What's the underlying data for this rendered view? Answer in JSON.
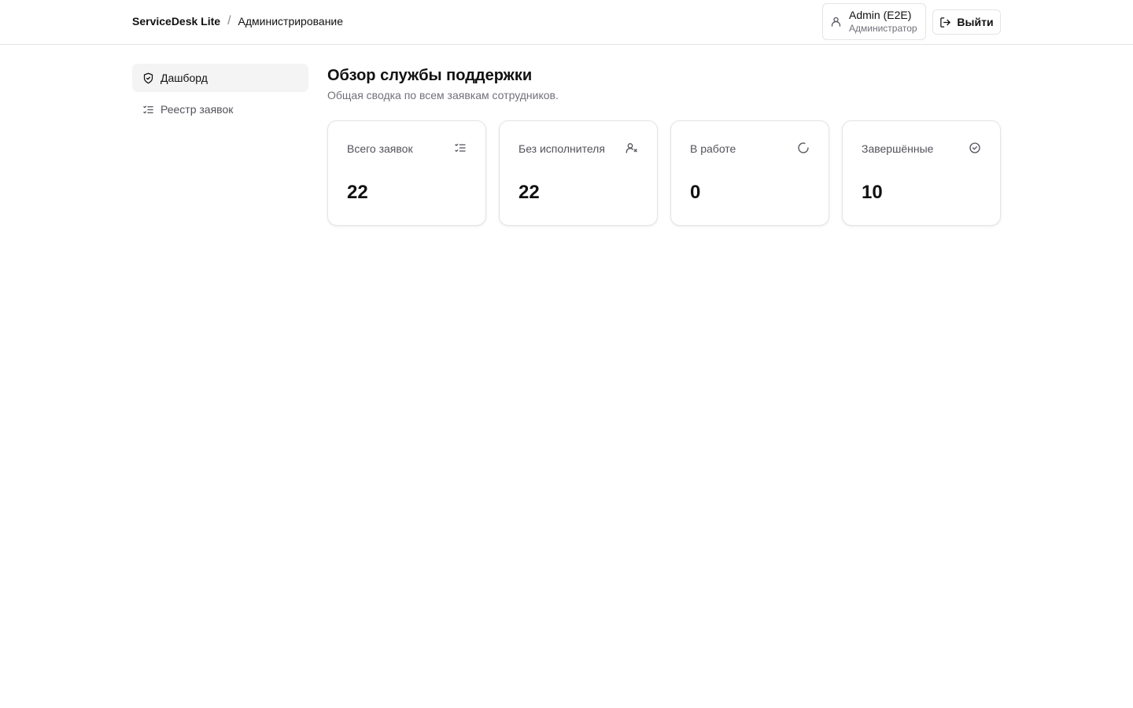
{
  "header": {
    "app_name": "ServiceDesk Lite",
    "separator": "/",
    "section": "Администрирование",
    "user": {
      "name": "Admin (E2E)",
      "role": "Администратор",
      "icon": "user-icon"
    },
    "logout": {
      "label": "Выйти",
      "icon": "logout-icon"
    }
  },
  "sidebar": {
    "items": [
      {
        "label": "Дашборд",
        "icon": "shield-check-icon",
        "active": true
      },
      {
        "label": "Реестр заявок",
        "icon": "list-checks-icon",
        "active": false
      }
    ]
  },
  "main": {
    "title": "Обзор службы поддержки",
    "subtitle": "Общая сводка по всем заявкам сотрудников."
  },
  "stats": [
    {
      "label": "Всего заявок",
      "value": "22",
      "icon": "list-checks-icon"
    },
    {
      "label": "Без исполнителя",
      "value": "22",
      "icon": "user-x-icon"
    },
    {
      "label": "В работе",
      "value": "0",
      "icon": "loader-icon"
    },
    {
      "label": "Завершённые",
      "value": "10",
      "icon": "check-circle-icon"
    }
  ],
  "colors": {
    "text": "#111111",
    "muted": "#71717a",
    "border": "#e4e4e7",
    "active_bg": "#f4f4f5"
  }
}
